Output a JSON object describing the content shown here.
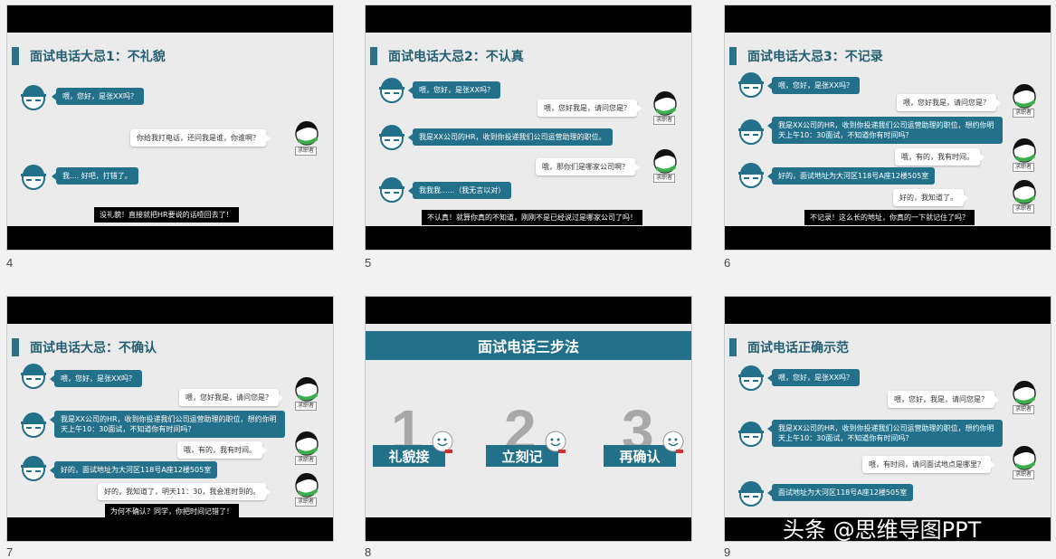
{
  "slides": {
    "s4": {
      "number": "4",
      "title": "面试电话大忌1：不礼貌",
      "lines": [
        "喂，您好，是张XX吗？",
        "你给我打电话，还问我是谁，你谁啊？",
        "我.... 好吧，打错了。"
      ],
      "seeker_label": "求职者",
      "note": "没礼貌！直接就把HR要说的话噎回去了！"
    },
    "s5": {
      "number": "5",
      "title": "面试电话大忌2：不认真",
      "lines": [
        "喂，您好，是张XX吗？",
        "喂，您好我是，请问您是？",
        "我是XX公司的HR，收到你投递我们公司运营助理的职位。",
        "哦，那你们是哪家公司啊？",
        "我我我......（我无言以对）"
      ],
      "seeker_label": "求职者",
      "note": "不认真！就算你真的不知道，刚刚不是已经说过是哪家公司了吗！"
    },
    "s6": {
      "number": "6",
      "title": "面试电话大忌3：不记录",
      "lines": [
        "喂，您好，是张XX吗？",
        "喂，您好我是，请问您是？",
        "我是XX公司的HR，收到你投递我们公司运营助理的职位，想约你明天上午10：30面试，不知道你有时间吗？",
        "哦，有的，我有时间。",
        "好的，面试地址为大河区118号A座12楼505室",
        "好的，我知道了。"
      ],
      "seeker_label": "求职者",
      "note": "不记录！这么长的地址，你真的一下就记住了吗？"
    },
    "s7": {
      "number": "7",
      "title": "面试电话大忌：不确认",
      "lines": [
        "喂，您好，是张XX吗？",
        "喂，您好我是，请问您是？",
        "我是XX公司的HR，收到你投递我们公司运营助理的职位，想约你明天上午10：30面试，不知道你有时间吗？",
        "哦，有的，我有时间。",
        "好的，面试地址为大河区118号A座12楼505室",
        "好的，我知道了，明天11：30，我会准时到的。"
      ],
      "seeker_label": "求职者",
      "note": "为何不确认？同学，你把时间记错了！"
    },
    "s8": {
      "number": "8",
      "banner": "面试电话三步法",
      "steps": [
        {
          "digit": "1",
          "label": "礼貌接"
        },
        {
          "digit": "2",
          "label": "立刻记"
        },
        {
          "digit": "3",
          "label": "再确认"
        }
      ]
    },
    "s9": {
      "number": "9",
      "title": "面试电话正确示范",
      "lines": [
        "喂，您好，是张XX吗？",
        "喂，您好，我是，请问您是？",
        "我是XX公司的HR，收到你投递我们公司运营助理的职位，想约你明天上午10：30面试，不知道你有时间吗？",
        "喂，有时间，请问面试地点是哪里？",
        "面试地址为大河区118号A座12楼505室"
      ],
      "seeker_label": "求职者"
    }
  },
  "watermark": "头条 @思维导图PPT",
  "colors": {
    "accent": "#23708a",
    "title": "#235f72",
    "background": "#ebebeb"
  }
}
